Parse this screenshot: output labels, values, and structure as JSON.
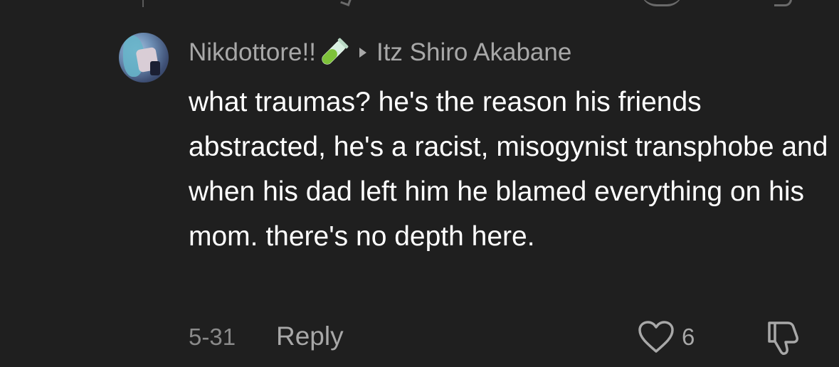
{
  "comment": {
    "username": "Nikdottore!!",
    "username_emoji": "test-tube-icon",
    "reply_to": "Itz Shiro Akabane",
    "body": "what traumas? he's the reason his friends abstracted, he's a racist, misogynist transphobe and when his dad left him he blamed everything on his mom. there's no depth here.",
    "date": "5-31",
    "reply_label": "Reply",
    "like_count": "6"
  },
  "colors": {
    "background": "#1f1f1f",
    "primary_text": "#ffffff",
    "secondary_text": "#a8a8a8",
    "date_text": "#8a8a8a",
    "tube_green": "#7ec23a"
  }
}
